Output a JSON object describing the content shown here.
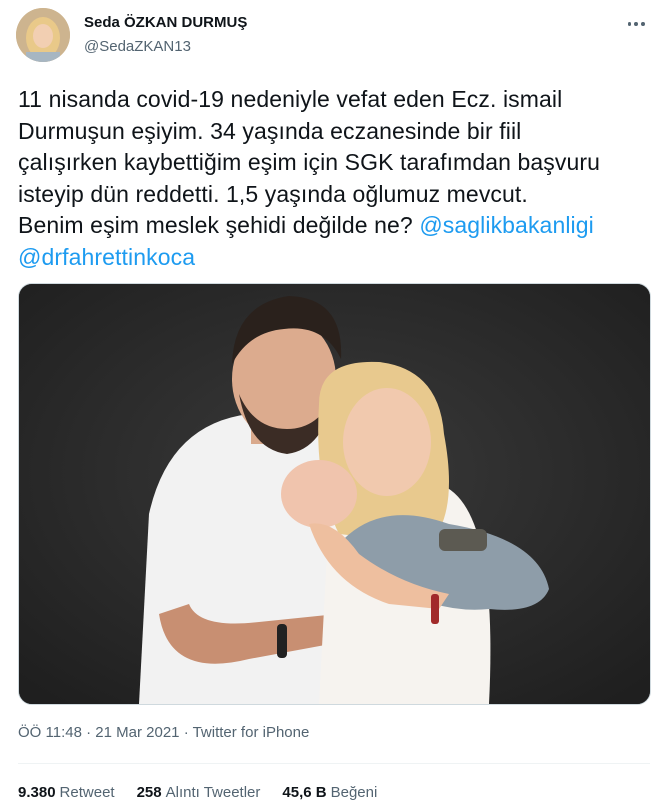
{
  "author": {
    "name": "Seda ÖZKAN DURMUŞ",
    "handle": "@SedaZKAN13"
  },
  "tweet": {
    "lines": [
      "11 nisanda covid-19 nedeniyle vefat eden Ecz. ismail",
      "Durmuşun eşiyim. 34 yaşında eczanesinde bir fiil",
      "çalışırken kaybettiğim eşim için SGK tarafımdan başvuru",
      "isteyip dün reddetti. 1,5 yaşında oğlumuz mevcut."
    ],
    "last_line_text": "Benim eşim meslek şehidi değilde ne?",
    "mention_1": "@saglikbakanligi",
    "mention_2": "@drfahrettinkoca"
  },
  "meta": {
    "time": "ÖÖ 11:48",
    "separator": "·",
    "date": "21 Mar 2021",
    "source": "Twitter for iPhone"
  },
  "stats": {
    "retweets_count": "9.380",
    "retweets_label": "Retweet",
    "quotes_count": "258",
    "quotes_label": "Alıntı Tweetler",
    "likes_count": "45,6 B",
    "likes_label": "Beğeni"
  },
  "icons": {
    "more": "more-horizontal-icon"
  },
  "colors": {
    "link": "#1d9bf0",
    "muted": "#536471",
    "text": "#0f1419"
  }
}
